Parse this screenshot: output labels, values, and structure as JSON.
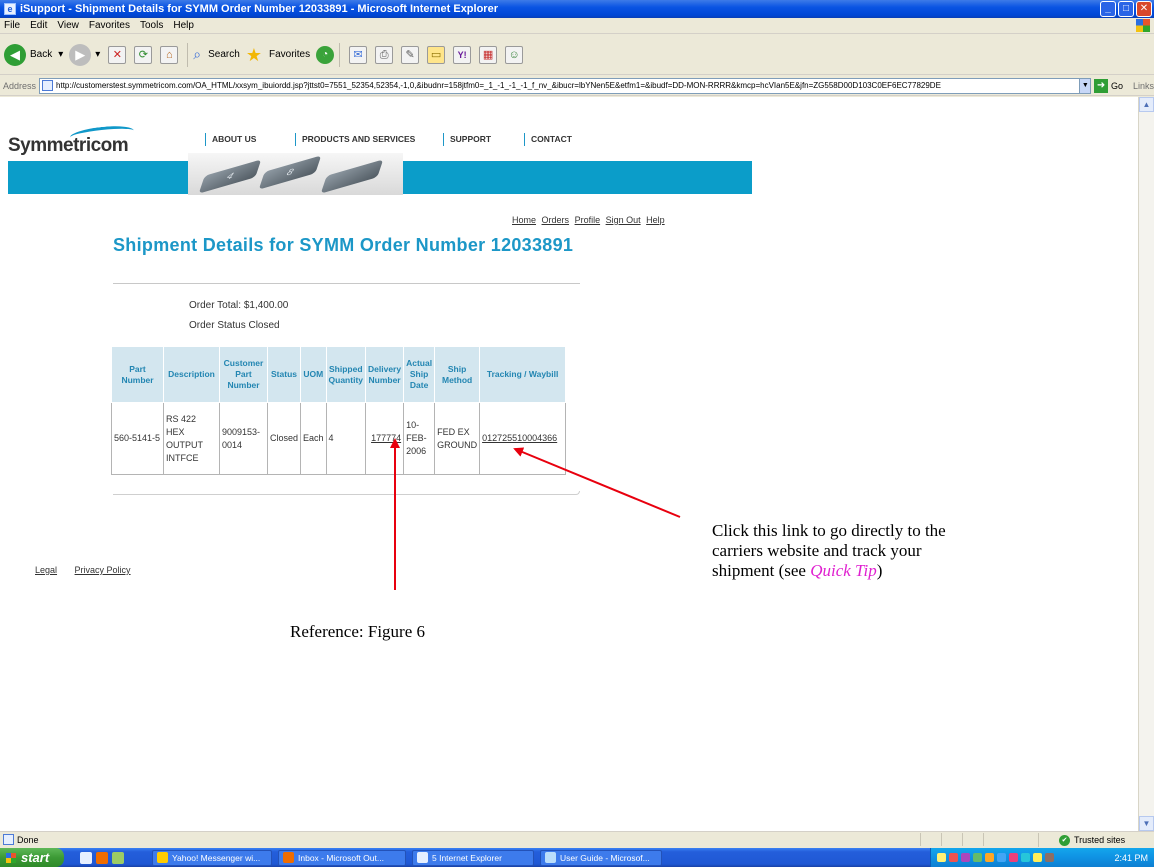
{
  "window": {
    "title": "iSupport - Shipment Details for SYMM Order Number 12033891 - Microsoft Internet Explorer"
  },
  "menu": [
    "File",
    "Edit",
    "View",
    "Favorites",
    "Tools",
    "Help"
  ],
  "toolbar": {
    "back": "Back",
    "search": "Search",
    "favorites": "Favorites"
  },
  "address": {
    "label": "Address",
    "url": "http://customerstest.symmetricom.com/OA_HTML/xxsym_ibuiordd.jsp?jttst0=7551_52354,52354,-1,0,&ibudnr=158jtfm0=_1_-1_-1_-1_f_nv_&ibucr=lbYNen5E&etfm1=&ibudf=DD-MON-RRRR&kmcp=hcVIan5E&jfn=ZG558D00D103C0EF6EC77829DE",
    "go": "Go",
    "links": "Links"
  },
  "site": {
    "logo": "Symmetricom",
    "nav": [
      "ABOUT US",
      "PRODUCTS AND SERVICES",
      "SUPPORT",
      "CONTACT"
    ],
    "util_links": [
      "Home",
      "Orders",
      "Profile",
      "Sign Out",
      "Help"
    ],
    "footer_links": [
      "Legal",
      "Privacy Policy"
    ]
  },
  "page": {
    "title": "Shipment Details for SYMM Order Number 12033891",
    "order_total_label": "Order Total:",
    "order_total": "$1,400.00",
    "order_status_label": "Order Status",
    "order_status": "Closed"
  },
  "table": {
    "headers": [
      "Part Number",
      "Description",
      "Customer Part Number",
      "Status",
      "UOM",
      "Shipped Quantity",
      "Delivery Number",
      "Actual Ship Date",
      "Ship Method",
      "Tracking / Waybill"
    ],
    "rows": [
      {
        "part_number": "560-5141-5",
        "description": "RS 422 HEX OUTPUT INTFCE",
        "customer_part_number": "9009153-0014",
        "status": "Closed",
        "uom": "Each",
        "shipped_quantity": "4",
        "delivery_number": "177774",
        "actual_ship_date": "10-FEB-2006",
        "ship_method": "FED EX GROUND",
        "tracking": "012725510004366"
      }
    ]
  },
  "annotations": {
    "reference": "Reference: Figure 6",
    "click_text": "Click this link to go directly to the carriers website and track your shipment (see",
    "quick_tip": "Quick Tip",
    "close_paren": ")"
  },
  "status": {
    "text": "Done",
    "zone": "Trusted sites"
  },
  "taskbar": {
    "start": "start",
    "tasks": [
      "Yahoo! Messenger wi...",
      "Inbox - Microsoft Out...",
      "5 Internet Explorer",
      "User Guide - Microsof..."
    ],
    "clock": "2:41 PM"
  },
  "colors": {
    "accent": "#1c97c7",
    "arrow": "#e8000e",
    "quick_tip": "#e020d0"
  }
}
